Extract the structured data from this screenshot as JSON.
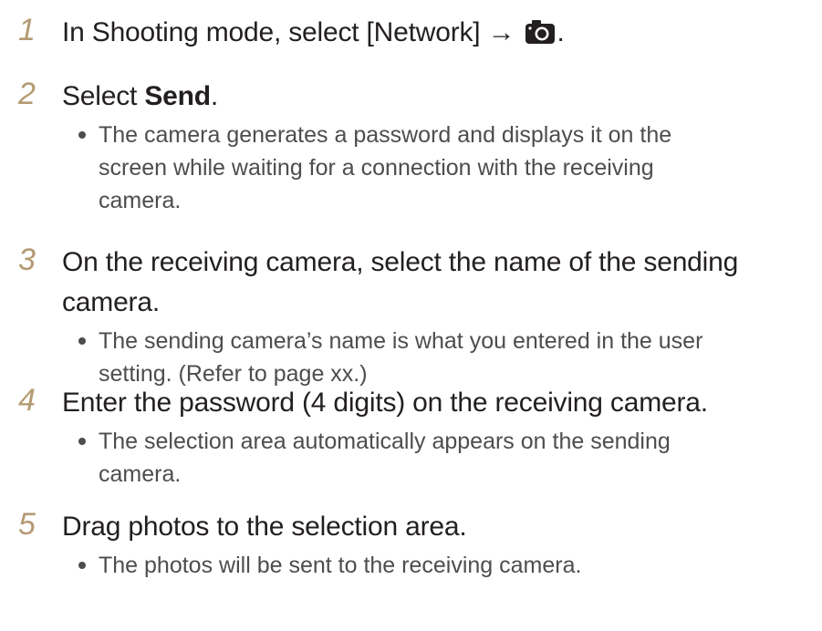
{
  "steps": [
    {
      "num": "1",
      "text_before": "In Shooting mode, select [Network] → ",
      "icon": "camera-icon",
      "text_after": ".",
      "bullets": []
    },
    {
      "num": "2",
      "text_before": "Select ",
      "bold": "Send",
      "text_after": ".",
      "bullets": [
        "The camera generates a password and displays it on the screen while waiting for a connection with the receiving camera."
      ]
    },
    {
      "num": "3",
      "text": "On the receiving camera, select the name of the sending camera.",
      "bullets": [
        "The sending camera’s name is what you entered in the user setting. (Refer to page xx.)"
      ]
    },
    {
      "num": "4",
      "text": "Enter the password (4 digits) on the receiving camera.",
      "bullets": [
        "The selection area automatically appears on the sending camera."
      ]
    },
    {
      "num": "5",
      "text": "Drag photos to the selection area.",
      "bullets": [
        "The photos will be sent to the receiving camera."
      ]
    }
  ],
  "colors": {
    "step_number": "#b49a73",
    "heading_text": "#231f20",
    "bullet_text": "#4d4d4f"
  }
}
